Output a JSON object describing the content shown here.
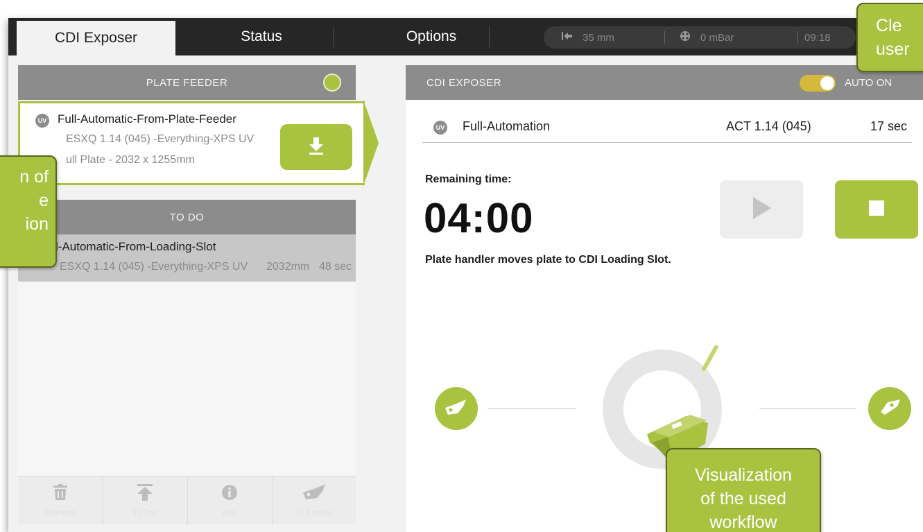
{
  "tabs": {
    "exposer": "CDI Exposer",
    "status": "Status",
    "options": "Options"
  },
  "status_bar": {
    "distance": "35 mm",
    "pressure": "0 mBar",
    "clock": "09:18",
    "distance_icon": "arrow-to-left-icon",
    "pressure_icon": "pump-icon"
  },
  "plate_feeder": {
    "header": "PLATE FEEDER",
    "indicator_color": "#a9c23f",
    "job": {
      "badge": "UV",
      "name": "Full-Automatic-From-Plate-Feeder",
      "line2": "ESXQ 1.14 (045) -Everything-XPS UV",
      "line3": "ull Plate - 2032 x 1255mm"
    },
    "load_icon": "download-icon"
  },
  "todo": {
    "header": "TO DO",
    "items": [
      {
        "name": "l-Automatic-From-Loading-Slot",
        "line2": "ESXQ 1.14 (045) -Everything-XPS UV",
        "size": "2032mm",
        "time": "48 sec"
      }
    ]
  },
  "toolbar": {
    "remove": "Remove",
    "to_top": "To Top",
    "info": "Info",
    "to_feeder": "To Feeder"
  },
  "exposer": {
    "header": "CDI EXPOSER",
    "auto_label": "AUTO ON",
    "auto_on": true,
    "job": {
      "badge": "UV",
      "name": "Full-Automation",
      "version": "ACT 1.14 (045)",
      "duration": "17 sec"
    },
    "remaining_label": "Remaining time:",
    "remaining_time": "04:00",
    "status_message": "Plate handler moves plate to CDI Loading Slot."
  },
  "callouts": {
    "top_right": [
      "Cle",
      "user"
    ],
    "left": [
      "n of",
      "e",
      "ion"
    ],
    "bottom": [
      "Visualization",
      "of the used",
      "workflow"
    ]
  },
  "colors": {
    "accent": "#a9c23f",
    "topbar": "#262626",
    "panel_header": "#8c8c8c",
    "toggle": "#d4b93a"
  }
}
